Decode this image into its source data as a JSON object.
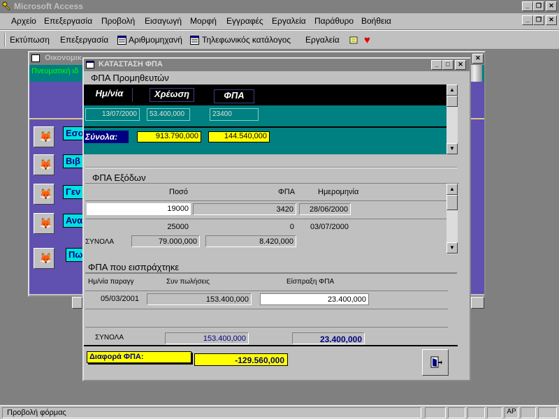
{
  "app": {
    "title": "Microsoft Access"
  },
  "menu": [
    "Αρχείο",
    "Επεξεργασία",
    "Προβολή",
    "Εισαγωγή",
    "Μορφή",
    "Εγγραφές",
    "Εργαλεία",
    "Παράθυρο",
    "Βοήθεια"
  ],
  "toolbar": {
    "print": "Εκτύπωση",
    "edit": "Επεξεργασία",
    "calculator": "Αριθμομηχανή",
    "phonebook": "Τηλεφωνικός κατάλογος",
    "tools": "Εργαλεία"
  },
  "bgwin": {
    "title": "Οικονομικ",
    "subtitle": "Πνευματική ιδ",
    "buttons": [
      "Εσο",
      "Βιβ",
      "Γεν",
      "Ανα",
      "Πω"
    ]
  },
  "fpa": {
    "title": "ΚΑΤΑΣΤΑΣΗ ΦΠΑ",
    "suppliers": {
      "heading": "ΦΠΑ Προμηθευτών",
      "col_date": "Ημ/νία",
      "col_charge": "Χρέωση",
      "col_vat": "ΦΠΑ",
      "row": {
        "date": "13/07/2000",
        "charge": "53.400,000",
        "vat": "23400"
      },
      "totals_label": "Σύνολα:",
      "total_charge": "913.790,000",
      "total_vat": "144.540,000"
    },
    "expenses": {
      "heading": "ΦΠΑ Εξόδων",
      "col_amount": "Ποσό",
      "col_vat": "ΦΠΑ",
      "col_date": "Ημερομηνία",
      "rows": [
        {
          "amount": "19000",
          "vat": "3420",
          "date": "28/06/2000"
        },
        {
          "amount": "25000",
          "vat": "0",
          "date": "03/07/2000"
        }
      ],
      "totals_label": "ΣΥΝΟΛΑ",
      "total_amount": "79.000,000",
      "total_vat": "8.420,000"
    },
    "collected": {
      "heading": "ΦΠΑ που εισπράχτηκε",
      "col_date": "Ημ/νία παραγγ",
      "col_sales": "Συν πωλήσεις",
      "col_collect": "Είσπραξη ΦΠΑ",
      "row": {
        "date": "05/03/2001",
        "sales": "153.400,000",
        "collect": "23.400,000"
      },
      "totals_label": "ΣΥΝΟΛΑ",
      "total_sales": "153.400,000",
      "total_collect": "23.400,000"
    },
    "diff_label": "Διαφορά ΦΠΑ:",
    "diff_value": "-129.560,000"
  },
  "status": {
    "text": "Προβολή φόρμας",
    "indicator": "ΑΡ"
  },
  "colors": {
    "teal": "#008080",
    "navy": "#000080",
    "yellow": "#ffff00",
    "purple": "#6050b0"
  }
}
